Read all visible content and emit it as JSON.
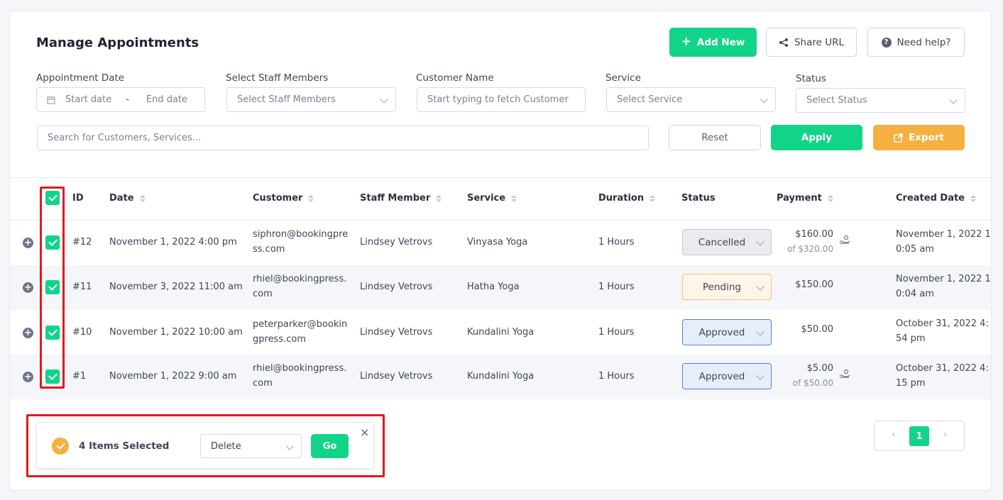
{
  "header": {
    "title": "Manage Appointments",
    "add_new": "Add New",
    "share_url": "Share URL",
    "need_help": "Need help?"
  },
  "filters": {
    "appointment_date_label": "Appointment Date",
    "start_date_placeholder": "Start date",
    "date_separator": "-",
    "end_date_placeholder": "End date",
    "staff_label": "Select Staff Members",
    "staff_placeholder": "Select Staff Members",
    "customer_label": "Customer Name",
    "customer_placeholder": "Start typing to fetch Customer",
    "service_label": "Service",
    "service_placeholder": "Select Service",
    "status_label": "Status",
    "status_placeholder": "Select Status",
    "search_placeholder": "Search for Customers, Services...",
    "reset": "Reset",
    "apply": "Apply",
    "export": "Export"
  },
  "table": {
    "columns": {
      "id": "ID",
      "date": "Date",
      "customer": "Customer",
      "staff": "Staff Member",
      "service": "Service",
      "duration": "Duration",
      "status": "Status",
      "payment": "Payment",
      "created": "Created Date"
    },
    "rows": [
      {
        "id": "#12",
        "date": "November 1, 2022 4:00 pm",
        "customer_l1": "siphron@bookingpre",
        "customer_l2": "ss.com",
        "staff": "Lindsey Vetrovs",
        "service": "Vinyasa Yoga",
        "duration": "1 Hours",
        "status": "Cancelled",
        "payment": "$160.00",
        "payment_of": "of $320.00",
        "created_l1": "November 1, 2022 1",
        "created_l2": "0:05 am"
      },
      {
        "id": "#11",
        "date": "November 3, 2022 11:00 am",
        "customer_l1": "rhiel@bookingpress.",
        "customer_l2": "com",
        "staff": "Lindsey Vetrovs",
        "service": "Hatha Yoga",
        "duration": "1 Hours",
        "status": "Pending",
        "payment": "$150.00",
        "payment_of": "",
        "created_l1": "November 1, 2022 1",
        "created_l2": "0:04 am"
      },
      {
        "id": "#10",
        "date": "November 1, 2022 10:00 am",
        "customer_l1": "peterparker@bookin",
        "customer_l2": "gpress.com",
        "staff": "Lindsey Vetrovs",
        "service": "Kundalini Yoga",
        "duration": "1 Hours",
        "status": "Approved",
        "payment": "$50.00",
        "payment_of": "",
        "created_l1": "October 31, 2022 4:",
        "created_l2": "54 pm"
      },
      {
        "id": "#1",
        "date": "November 1, 2022 9:00 am",
        "customer_l1": "rhiel@bookingpress.",
        "customer_l2": "com",
        "staff": "Lindsey Vetrovs",
        "service": "Kundalini Yoga",
        "duration": "1 Hours",
        "status": "Approved",
        "payment": "$5.00",
        "payment_of": "of $50.00",
        "created_l1": "October 31, 2022 4:",
        "created_l2": "15 pm"
      }
    ]
  },
  "bulk": {
    "selected_text": "4 Items Selected",
    "action": "Delete",
    "go": "Go",
    "close": "×"
  },
  "pagination": {
    "prev": "‹",
    "current": "1",
    "next": "›"
  },
  "colors": {
    "accent": "#12d488",
    "export": "#f5b041",
    "highlight": "#e3191c"
  },
  "icons": [
    "plus-icon",
    "share-icon",
    "help-icon",
    "calendar-icon",
    "export-icon",
    "check-icon",
    "expand-icon",
    "refund-icon",
    "close-icon"
  ]
}
